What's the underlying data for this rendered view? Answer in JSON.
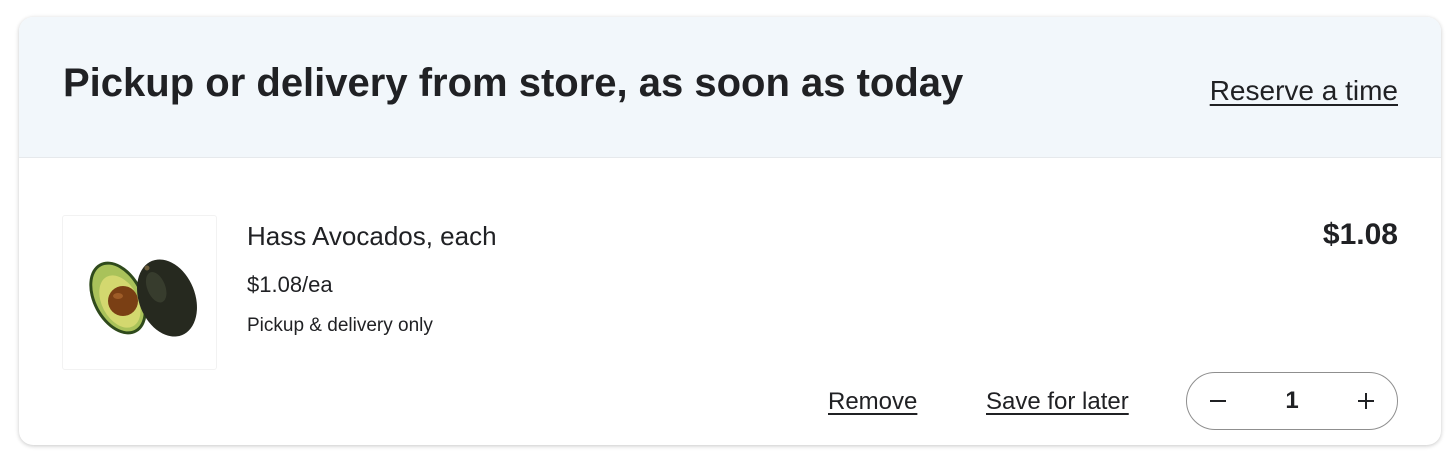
{
  "header": {
    "title": "Pickup or delivery from store, as soon as today",
    "reserve_link": "Reserve a time"
  },
  "item": {
    "image_icon": "avocado-icon",
    "name": "Hass Avocados, each",
    "unit_price": "$1.08/ea",
    "fulfillment": "Pickup & delivery only",
    "line_price": "$1.08",
    "quantity": "1",
    "remove_label": "Remove",
    "save_label": "Save for later",
    "decrease_icon": "minus-icon",
    "increase_icon": "plus-icon"
  },
  "colors": {
    "header_background": "#f2f7fb",
    "text": "#202124",
    "stepper_border": "#8f8f8f"
  }
}
